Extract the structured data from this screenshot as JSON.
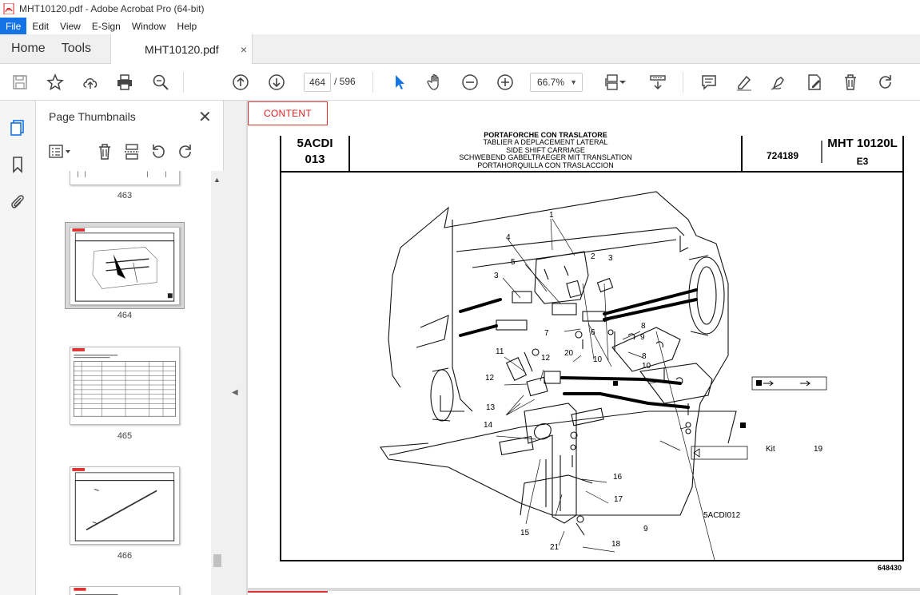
{
  "window": {
    "title": "MHT10120.pdf - Adobe Acrobat Pro (64-bit)"
  },
  "menu": {
    "items": [
      "File",
      "Edit",
      "View",
      "E-Sign",
      "Window",
      "Help"
    ]
  },
  "nav_tabs": {
    "home": "Home",
    "tools": "Tools"
  },
  "doc_tab": {
    "name": "MHT10120.pdf",
    "close": "×"
  },
  "toolbar": {
    "current_page": "464",
    "total_pages": "/ 596",
    "zoom": "66.7%"
  },
  "thumbnails": {
    "title": "Page Thumbnails",
    "close": "✕",
    "pages": [
      "463",
      "464",
      "465",
      "466"
    ],
    "selected_page": "464"
  },
  "document": {
    "content_button": "CONTENT",
    "header": {
      "code_top": "5ACDI",
      "code_bottom": "013",
      "title_lines": [
        "PORTAFORCHE CON TRASLATORE",
        "TABLIER A DEPLACEMENT LATERAL",
        "SIDE SHIFT CARRIAGE",
        "SCHWEBEND GABELTRAEGER MIT TRANSLATION",
        "PORTAHORQUILLA CON TRASLACCION"
      ],
      "ref": "724189",
      "model": "MHT 10120L",
      "edition": "E3"
    },
    "diagram": {
      "callouts": [
        "1",
        "2",
        "3",
        "3",
        "4",
        "5",
        "6",
        "7",
        "7",
        "8",
        "8",
        "9",
        "9",
        "10",
        "10",
        "11",
        "12",
        "12",
        "13",
        "14",
        "15",
        "16",
        "17",
        "18",
        "20",
        "21"
      ],
      "kit_note": {
        "kit_label": "Kit",
        "kit_ref": "19"
      },
      "cross_ref": "5ACDI012"
    },
    "footer_code": "648430"
  }
}
